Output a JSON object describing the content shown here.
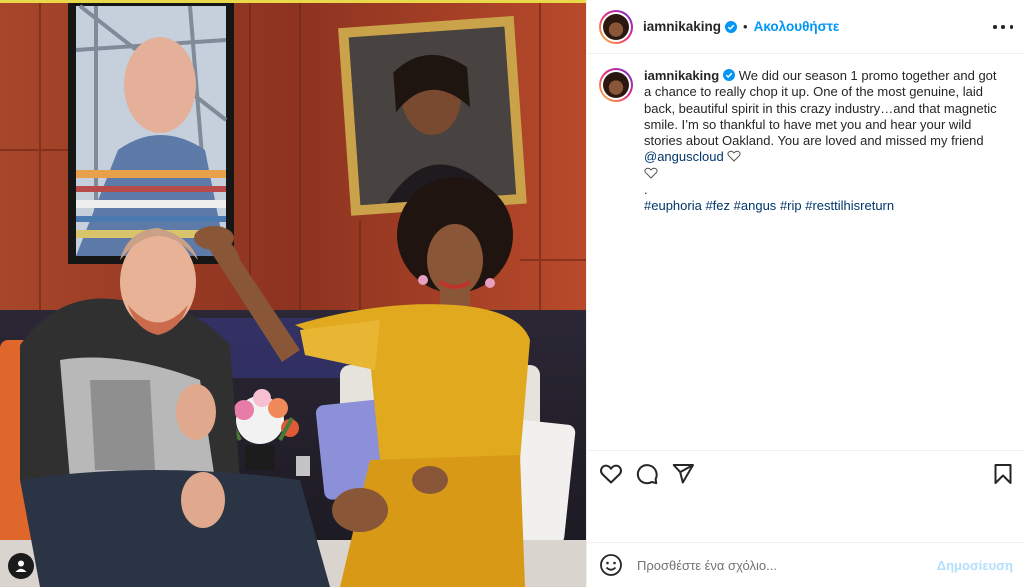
{
  "post": {
    "username": "iamnikaking",
    "follow_label": "Ακολουθήστε",
    "separator": "•",
    "caption": {
      "username": "iamnikaking",
      "body": "We did our season 1 promo together and got a chance to really chop it up. One of the most genuine, laid back, beautiful spirit in this crazy industry…and that magnetic smile. I’m so thankful to have met you and hear your wild stories about Oakland. You are loved and missed my friend",
      "mention": "@anguscloud",
      "dot_line": ".",
      "hashtags": [
        "#euphoria",
        "#fez",
        "#angus",
        "#rip",
        "#resttilhisreturn"
      ]
    },
    "comment": {
      "placeholder": "Προσθέστε ένα σχόλιο...",
      "post_label": "Δημοσίευση"
    }
  },
  "icons": {
    "verified": "verified-badge-icon",
    "more": "more-options-icon",
    "like": "heart-icon",
    "comment": "comment-icon",
    "share": "paper-plane-icon",
    "save": "bookmark-icon",
    "emoji": "smiley-icon",
    "user_tags": "user-tag-icon",
    "caption_emoji": "white-heart-doves-icon"
  },
  "colors": {
    "accent": "#0095f6",
    "mention": "#00376b",
    "post_disabled": "#b2dffc",
    "wall": "#9a3a22",
    "dress": "#e0a91e"
  }
}
